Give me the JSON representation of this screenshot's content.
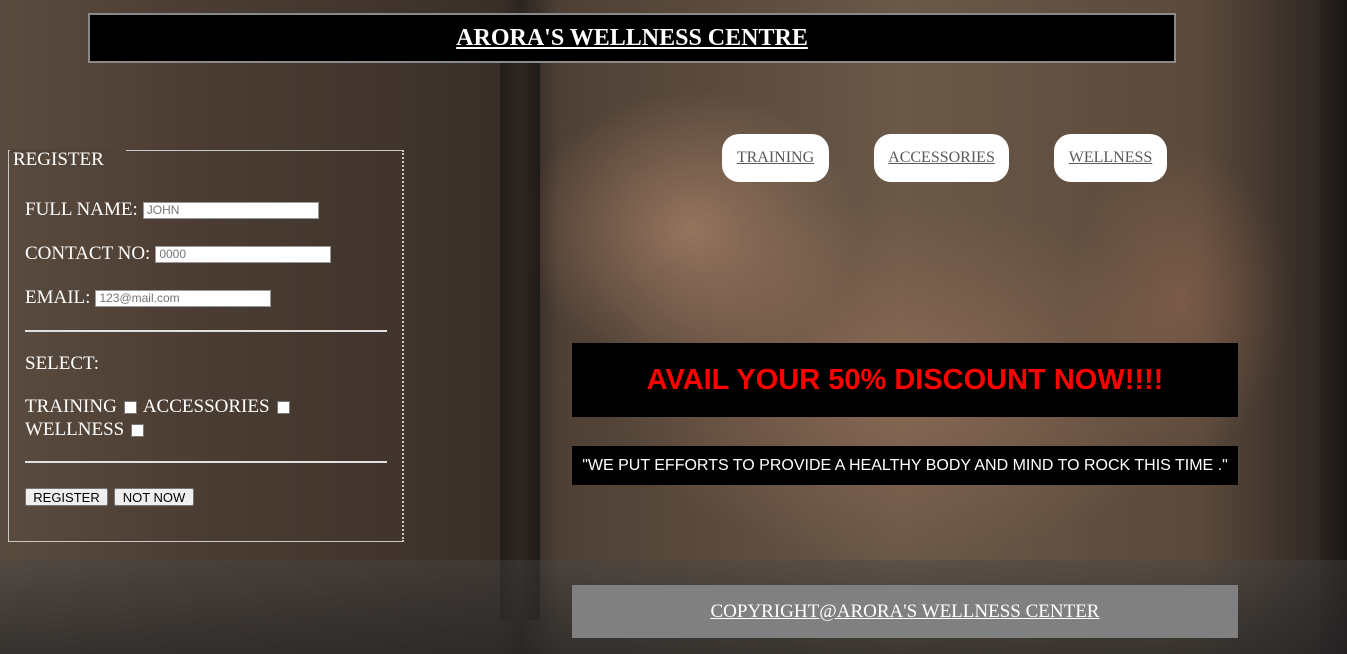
{
  "header": {
    "title": "ARORA'S WELLNESS CENTRE"
  },
  "register": {
    "legend": "REGISTER",
    "full_name_label": "FULL NAME:",
    "full_name_placeholder": "JOHN",
    "contact_label": "CONTACT NO:",
    "contact_placeholder": "0000",
    "email_label": "EMAIL:",
    "email_placeholder": "123@mail.com",
    "select_label": "SELECT:",
    "options": [
      "TRAINING",
      "ACCESSORIES",
      "WELLNESS"
    ],
    "register_button": "REGISTER",
    "not_now_button": "NOT NOW"
  },
  "nav": {
    "items": [
      "TRAINING",
      "ACCESSORIES",
      "WELLNESS"
    ]
  },
  "promo": {
    "discount": "AVAIL YOUR 50% DISCOUNT NOW!!!!",
    "quote": "\"WE PUT EFFORTS TO PROVIDE A HEALTHY BODY AND MIND TO ROCK THIS TIME .\""
  },
  "footer": {
    "text": "COPYRIGHT@ARORA'S WELLNESS CENTER"
  },
  "colors": {
    "discount_text": "#ff0000",
    "banner_bg": "#000000",
    "footer_bg": "#808080"
  }
}
